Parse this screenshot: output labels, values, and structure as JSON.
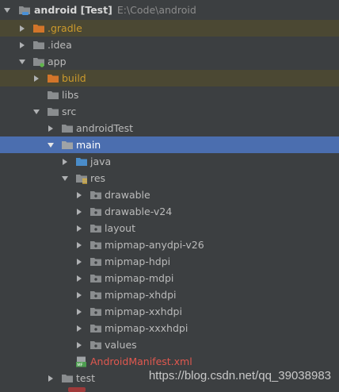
{
  "tree": [
    {
      "label": "android [Test]",
      "path": "E:\\Code\\android",
      "arrow": "down",
      "icon": "module-icon",
      "color": "#d6d6d6",
      "bold": true
    },
    {
      "label": ".gradle",
      "arrow": "right",
      "icon": "folder-orange-icon",
      "color": "#cc9a2c",
      "ignored": true
    },
    {
      "label": ".idea",
      "arrow": "right",
      "icon": "folder-grey-icon",
      "color": "#bbbbbb"
    },
    {
      "label": "app",
      "arrow": "down",
      "icon": "android-module-folder-icon",
      "color": "#bbbbbb"
    },
    {
      "label": "build",
      "arrow": "right",
      "icon": "folder-orange-icon",
      "color": "#cc9a2c",
      "ignored": true
    },
    {
      "label": "libs",
      "arrow": "none",
      "icon": "folder-grey-icon",
      "color": "#bbbbbb"
    },
    {
      "label": "src",
      "arrow": "down",
      "icon": "folder-grey-icon",
      "color": "#bbbbbb"
    },
    {
      "label": "androidTest",
      "arrow": "right",
      "icon": "folder-grey-icon",
      "color": "#bbbbbb"
    },
    {
      "label": "main",
      "arrow": "down",
      "icon": "folder-grey-icon",
      "color": "#ffffff",
      "selected": true
    },
    {
      "label": "java",
      "arrow": "right",
      "icon": "folder-blue-icon",
      "color": "#bbbbbb"
    },
    {
      "label": "res",
      "arrow": "down",
      "icon": "res-folder-icon",
      "color": "#bbbbbb"
    },
    {
      "label": "drawable",
      "arrow": "right",
      "icon": "package-folder-icon",
      "color": "#bbbbbb"
    },
    {
      "label": "drawable-v24",
      "arrow": "right",
      "icon": "package-folder-icon",
      "color": "#bbbbbb"
    },
    {
      "label": "layout",
      "arrow": "right",
      "icon": "package-folder-icon",
      "color": "#bbbbbb"
    },
    {
      "label": "mipmap-anydpi-v26",
      "arrow": "right",
      "icon": "package-folder-icon",
      "color": "#bbbbbb"
    },
    {
      "label": "mipmap-hdpi",
      "arrow": "right",
      "icon": "package-folder-icon",
      "color": "#bbbbbb"
    },
    {
      "label": "mipmap-mdpi",
      "arrow": "right",
      "icon": "package-folder-icon",
      "color": "#bbbbbb"
    },
    {
      "label": "mipmap-xhdpi",
      "arrow": "right",
      "icon": "package-folder-icon",
      "color": "#bbbbbb"
    },
    {
      "label": "mipmap-xxhdpi",
      "arrow": "right",
      "icon": "package-folder-icon",
      "color": "#bbbbbb"
    },
    {
      "label": "mipmap-xxxhdpi",
      "arrow": "right",
      "icon": "package-folder-icon",
      "color": "#bbbbbb"
    },
    {
      "label": "values",
      "arrow": "right",
      "icon": "package-folder-icon",
      "color": "#bbbbbb"
    },
    {
      "label": "AndroidManifest.xml",
      "arrow": "none",
      "icon": "manifest-file-icon",
      "color": "#e0584f"
    },
    {
      "label": "test",
      "arrow": "right",
      "icon": "folder-grey-icon",
      "color": "#bbbbbb"
    }
  ],
  "watermark": "https://blog.csdn.net/qq_39038983",
  "colors": {
    "background": "#3c3f41",
    "selection": "#4b6eaf",
    "ignored_bg": "#4b4833",
    "ignored_text": "#cc9a2c",
    "error_text": "#e0584f"
  }
}
